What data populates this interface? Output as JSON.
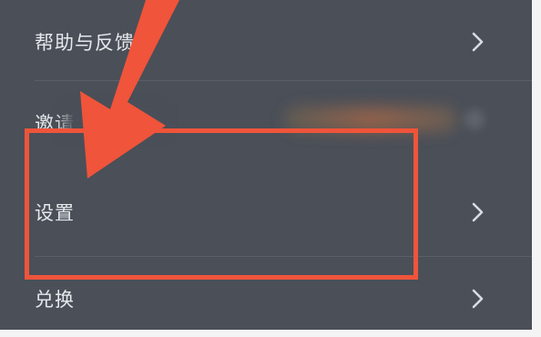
{
  "menu": {
    "items": [
      {
        "label": "帮助与反馈",
        "icon": "chevron-right-icon"
      },
      {
        "label": "邀请"
      },
      {
        "label": "设置",
        "icon": "chevron-right-icon"
      },
      {
        "label": "兑换",
        "icon": "chevron-right-icon"
      }
    ]
  },
  "annotation": {
    "color": "#f0543a"
  }
}
